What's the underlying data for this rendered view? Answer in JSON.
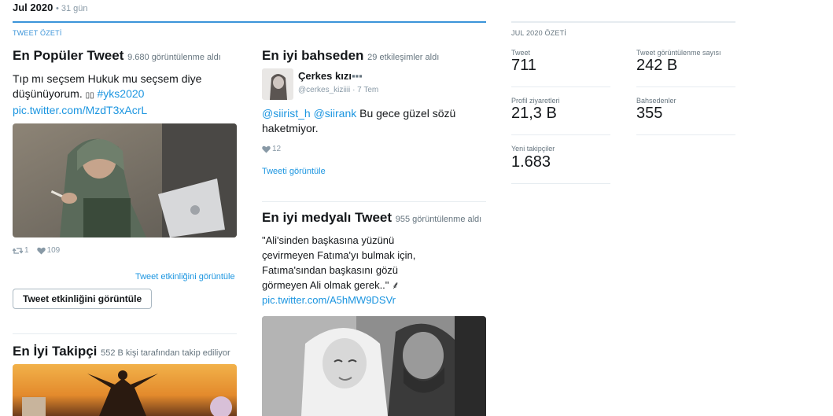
{
  "header": {
    "month": "Jul 2020",
    "days": "• 31 gün"
  },
  "tweet_summary": {
    "label": "TWEET ÖZETİ",
    "top_tweet": {
      "title": "En Popüler Tweet",
      "meta": "9.680 görüntülenme aldı",
      "text_line1": "Tıp mı seçsem Hukuk mu seçsem diye",
      "text_line2": "düşünüyorum. ",
      "emoji": "▯▯",
      "hashtag": "#yks2020",
      "link": "pic.twitter.com/MzdT3xAcrL",
      "retweets": "1",
      "likes": "109",
      "activity_link": "Tweet etkinliğini görüntüle",
      "activity_button": "Tweet etkinliğini görüntüle"
    },
    "top_mention": {
      "title": "En iyi bahseden",
      "meta": "29 etkileşimler aldı",
      "user_name": "Çerkes kızı",
      "user_handle": "@cerkes_kiziiii",
      "user_time": "· 7 Tem",
      "mention1": "@siirist_h",
      "mention2": "@siirank",
      "text_rest": " Bu gece güzel sözü",
      "text_line2": "haketmiyor.",
      "likes": "12",
      "view_link": "Tweeti görüntüle"
    },
    "top_media": {
      "title": "En iyi medyalı Tweet",
      "meta": "955 görüntülenme aldı",
      "line1": "\"Ali'sinden başkasına yüzünü",
      "line2": "çevirmeyen Fatıma'yı bulmak için,",
      "line3": "Fatıma'sından başkasını gözü",
      "line4": "görmeyen Ali olmak gerek..\" ",
      "emoji": "⸙",
      "link": "pic.twitter.com/A5hMW9DSVr"
    },
    "top_follower": {
      "title": "En İyi Takipçi",
      "meta": "552 B kişi tarafından takip ediliyor"
    }
  },
  "month_summary": {
    "label": "JUL 2020 ÖZETİ",
    "stats": [
      {
        "label": "Tweet",
        "value": "711"
      },
      {
        "label": "Tweet görüntülenme sayısı",
        "value": "242 B"
      },
      {
        "label": "Profil ziyaretleri",
        "value": "21,3 B"
      },
      {
        "label": "Bahsedenler",
        "value": "355"
      },
      {
        "label": "Yeni takipçiler",
        "value": "1.683"
      }
    ]
  },
  "icons": {
    "retweet": "retweet-icon",
    "like": "heart-icon"
  },
  "colors": {
    "accent": "#1b95e0",
    "line": "#3b94d9"
  }
}
